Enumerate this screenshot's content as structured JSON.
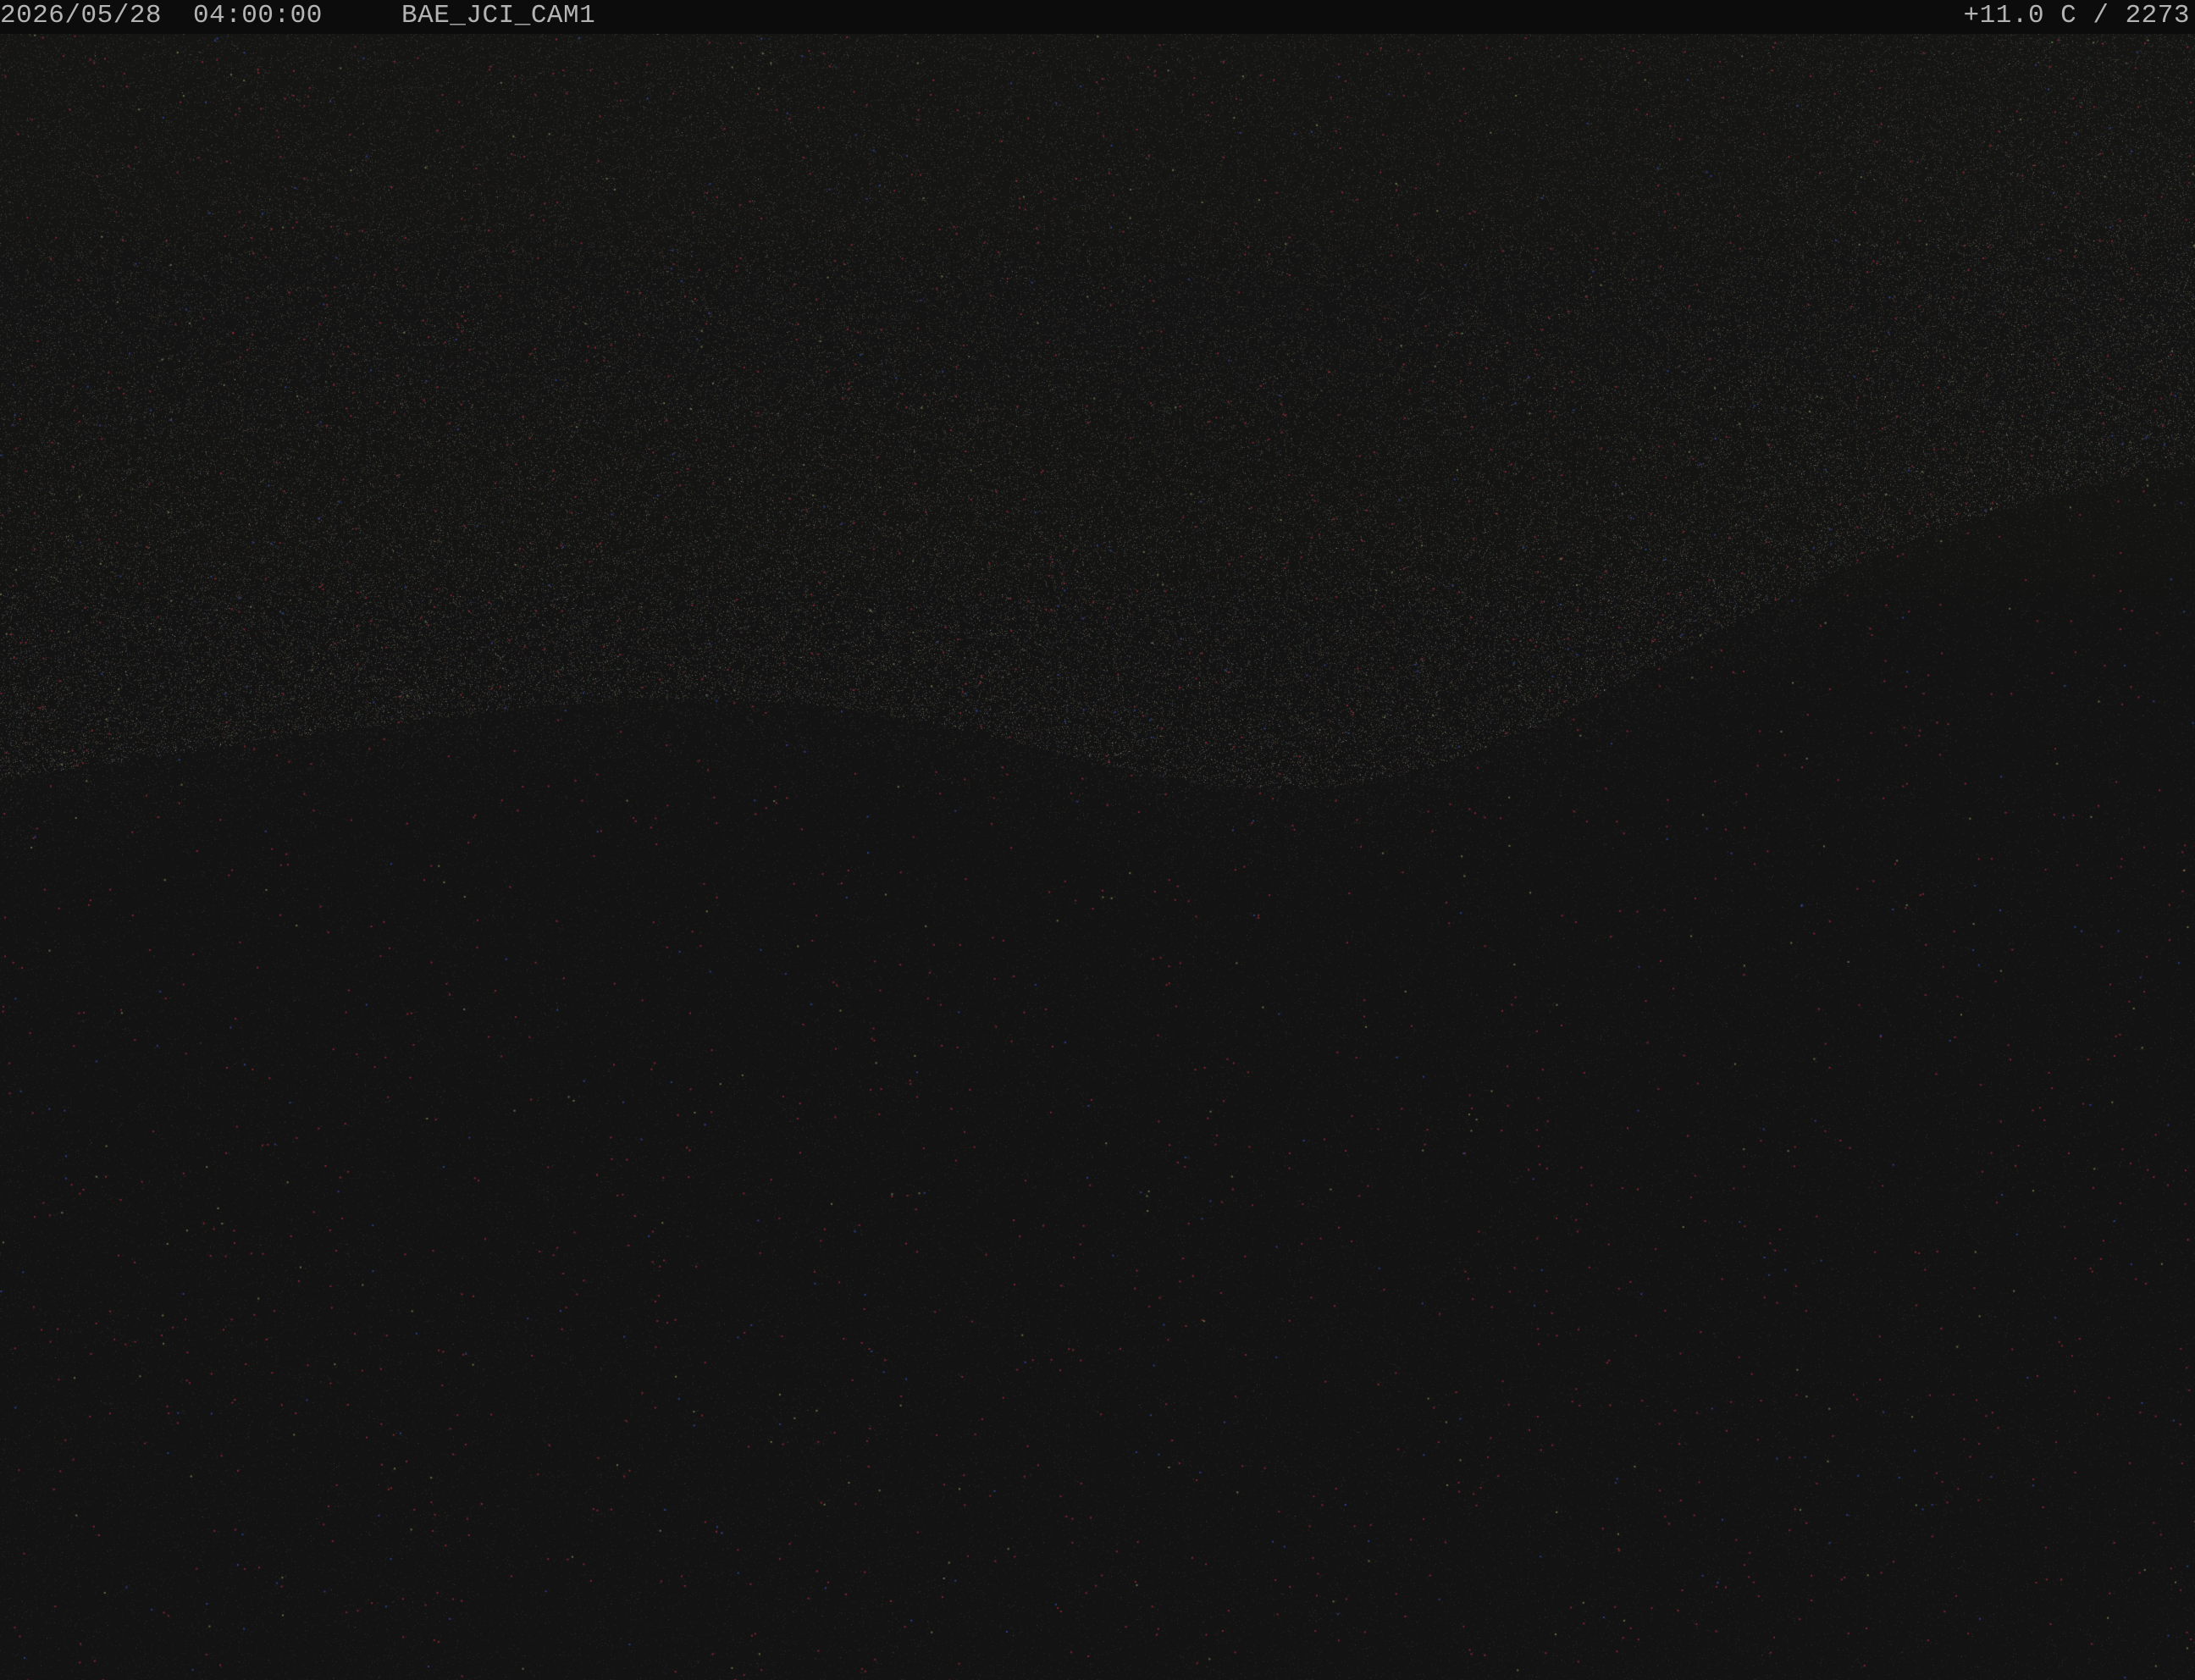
{
  "overlay": {
    "date": "2026/05/28",
    "time": "04:00:00",
    "camera_name": "BAE_JCI_CAM1",
    "temperature": "+11.0 C",
    "separator": " / ",
    "frame_value": "2273"
  },
  "scene": {
    "description_colors": {
      "background": "#131313",
      "haze": "#2a2a22",
      "noise_red": "#7a2a32",
      "noise_green": "#4a5a3a",
      "noise_blue": "#2a3a7a"
    }
  }
}
